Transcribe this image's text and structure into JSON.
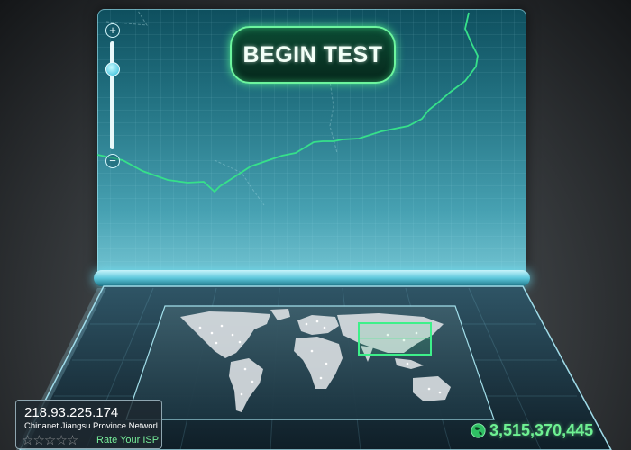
{
  "main": {
    "begin_button": "BEGIN TEST",
    "zoom_in": "+",
    "zoom_out": "−"
  },
  "isp": {
    "ip": "218.93.225.174",
    "name": "Chinanet Jiangsu Province Networl",
    "stars": "☆☆☆☆☆",
    "rating": 0,
    "rate_label": "Rate Your ISP"
  },
  "counter": {
    "value": "3,515,370,445",
    "icon": "globe-icon"
  },
  "colors": {
    "accent": "#5df08c",
    "panel": "#47a1b2",
    "route_line": "#36e08a"
  }
}
